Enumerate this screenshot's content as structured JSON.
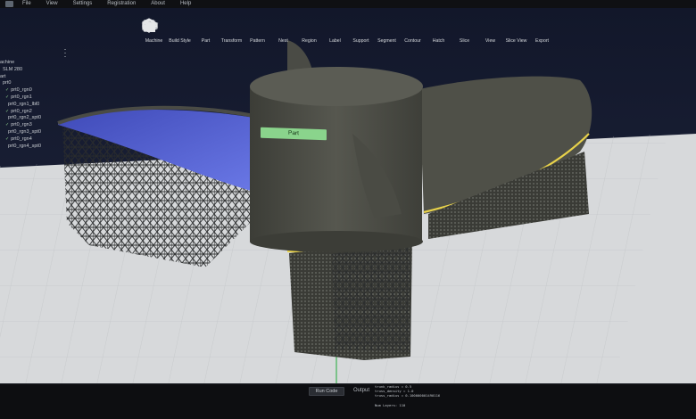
{
  "menu": {
    "items": [
      "File",
      "View",
      "Settings",
      "Registration",
      "About",
      "Help"
    ]
  },
  "toolbar": {
    "tools": [
      {
        "label": "Machine",
        "icon": "machine-icon"
      },
      {
        "label": "Build Style",
        "icon": "build-style-icon"
      },
      {
        "label": "Part",
        "icon": "part-icon"
      },
      {
        "label": "Transform",
        "icon": "transform-icon"
      },
      {
        "label": "Pattern",
        "icon": "pattern-icon"
      },
      {
        "label": "Nest",
        "icon": "nest-icon"
      },
      {
        "label": "Region",
        "icon": "region-icon"
      },
      {
        "label": "Label",
        "icon": "label-icon"
      },
      {
        "label": "Support",
        "icon": "support-icon"
      },
      {
        "label": "Segment",
        "icon": "segment-icon"
      },
      {
        "label": "Contour",
        "icon": "contour-icon"
      },
      {
        "label": "Hatch",
        "icon": "hatch-icon"
      },
      {
        "label": "Slice",
        "icon": "slice-icon"
      },
      {
        "label": "View",
        "icon": "view-icon"
      },
      {
        "label": "Slice View",
        "icon": "slice-view-icon"
      },
      {
        "label": "Export",
        "icon": "export-icon"
      }
    ]
  },
  "tree": {
    "rows": [
      {
        "text": "achine",
        "checked": false,
        "indent": 0
      },
      {
        "text": "SLM 280",
        "checked": false,
        "indent": 1
      },
      {
        "text": "art",
        "checked": false,
        "indent": 0
      },
      {
        "text": "prt0",
        "checked": false,
        "indent": 1
      },
      {
        "text": "prt0_rgn0",
        "checked": true,
        "indent": 2
      },
      {
        "text": "prt0_rgn1",
        "checked": true,
        "indent": 2
      },
      {
        "text": "prt0_rgn1_lbl0",
        "checked": false,
        "indent": 3
      },
      {
        "text": "prt0_rgn2",
        "checked": true,
        "indent": 2
      },
      {
        "text": "prt0_rgn2_spt0",
        "checked": false,
        "indent": 3
      },
      {
        "text": "prt0_rgn3",
        "checked": true,
        "indent": 2
      },
      {
        "text": "prt0_rgn3_spt0",
        "checked": false,
        "indent": 3
      },
      {
        "text": "prt0_rgn4",
        "checked": true,
        "indent": 2
      },
      {
        "text": "prt0_rgn4_spt0",
        "checked": false,
        "indent": 3
      }
    ]
  },
  "scene": {
    "part_label": "Part",
    "colors": {
      "part": "#4f5048",
      "selected_face": "#5a66d8",
      "edge_highlight": "#e8d24a",
      "build_plate": "#d6d8da",
      "support": "#2b2d2e",
      "label_tag": "#8ad48c"
    }
  },
  "bottom": {
    "run_button": "Run Code",
    "output_label": "Output",
    "console_lines": [
      "trunk_radius = 0.5",
      "truss_density = 1.0",
      "truss_radius = 0.100000001490116",
      "",
      "Num Layers: 110"
    ]
  }
}
